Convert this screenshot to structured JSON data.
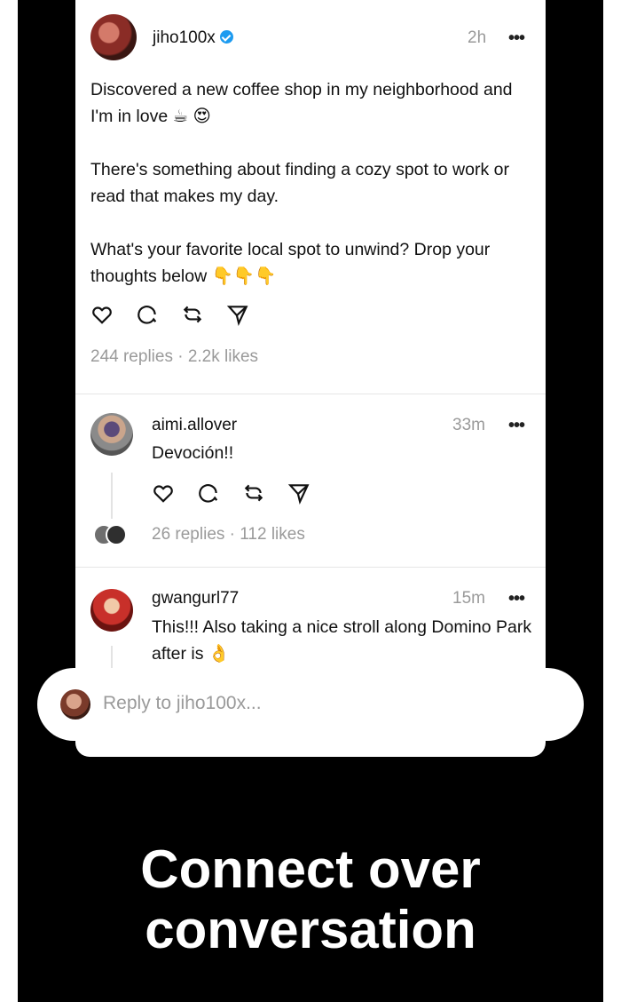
{
  "main_post": {
    "username": "jiho100x",
    "time": "2h",
    "more": "•••",
    "paragraphs": [
      "Discovered a new coffee shop in my neighborhood and I'm in love ☕ 😍",
      "There's something about finding a cozy spot to work or read that makes my day.",
      "What's your favorite local spot to unwind? Drop your thoughts below 👇👇👇"
    ],
    "stats": "244 replies · 2.2k likes"
  },
  "replies": [
    {
      "username": "aimi.allover",
      "time": "33m",
      "more": "•••",
      "text": "Devoción!!",
      "stats": "26 replies · 112 likes"
    },
    {
      "username": "gwangurl77",
      "time": "15m",
      "more": "•••",
      "text": "This!!! Also taking a nice stroll along Domino Park after is 👌"
    }
  ],
  "reply_bar": {
    "placeholder": "Reply to jiho100x..."
  },
  "caption": {
    "line1": "Connect over",
    "line2": "conversation"
  },
  "colors": {
    "background": "#000000",
    "card": "#ffffff",
    "muted_text": "#9a9a9a",
    "verified": "#1d9bf0"
  }
}
